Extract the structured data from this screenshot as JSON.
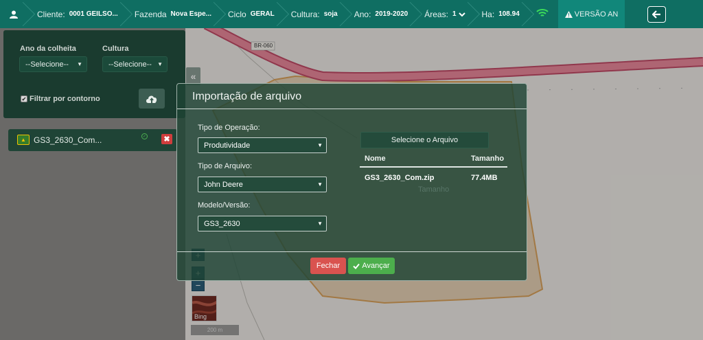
{
  "topbar": {
    "cliente": {
      "label": "Cliente:",
      "value": "0001 GEILSO..."
    },
    "fazenda": {
      "label": "Fazenda",
      "value": "Nova Espe..."
    },
    "ciclo": {
      "label": "Ciclo",
      "value": "GERAL"
    },
    "cultura": {
      "label": "Cultura:",
      "value": "soja"
    },
    "ano": {
      "label": "Ano:",
      "value": "2019-2020"
    },
    "areas": {
      "label": "Áreas:",
      "value": "1"
    },
    "ha": {
      "label": "Ha:",
      "value": "108.94"
    },
    "warning": "VERSÃO AN"
  },
  "map": {
    "road_label": "BR-060",
    "scale_label": "200 m",
    "bing_label": "Bing",
    "zoom_in": "+",
    "zoom_out": "−"
  },
  "left_panel": {
    "ano_colheita_label": "Ano da colheita",
    "ano_colheita_value": "--Selecione--",
    "cultura_label": "Cultura",
    "cultura_value": "--Selecione--",
    "filtrar_label": "Filtrar por contorno",
    "filtrar_checked": true,
    "file_name": "GS3_2630_Com...",
    "delete_label": "✖"
  },
  "modal": {
    "title": "Importação de arquivo",
    "tipo_operacao_label": "Tipo de Operação:",
    "tipo_operacao_value": "Produtividade",
    "tipo_arquivo_label": "Tipo de Arquivo:",
    "tipo_arquivo_value": "John Deere",
    "modelo_label": "Modelo/Versão:",
    "modelo_value": "GS3_2630",
    "select_file_label": "Selecione o Arquivo",
    "table": {
      "headers": [
        "Nome",
        "Tamanho"
      ],
      "rows": [
        [
          "GS3_2630_Com.zip",
          "77.4MB"
        ]
      ]
    },
    "ghost_text": "Tamanho",
    "fechar_label": "Fechar",
    "avancar_label": "Avançar"
  },
  "colors": {
    "topbar": "#0f6e62",
    "accent_green": "#4cae4c",
    "danger_red": "#d9534f",
    "road": "#d9607a",
    "field_orange": "#d9a05a"
  },
  "icons": [
    "user-icon",
    "chevron-down-icon",
    "wifi-icon",
    "warning-icon",
    "arrow-left-icon",
    "cloud-upload-icon",
    "john-deere-icon",
    "check-circle-icon",
    "close-icon",
    "double-chevron-left-icon",
    "check-icon"
  ]
}
